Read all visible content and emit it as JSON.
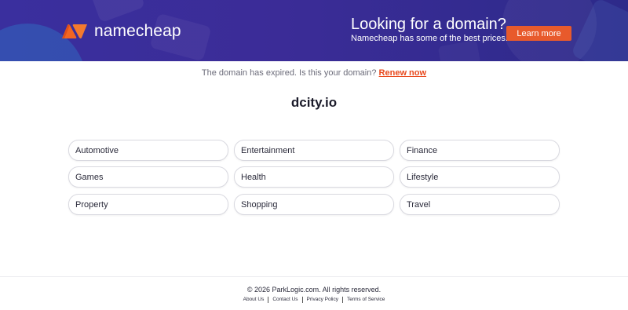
{
  "banner": {
    "brand": "namecheap",
    "promo_title": "Looking for a domain?",
    "promo_subtitle": "Namecheap has some of the best prices.",
    "cta_label": "Learn more",
    "colors": {
      "background": "#3a2f9e",
      "cta": "#e85a2c",
      "logo_orange": "#f26522"
    }
  },
  "notice": {
    "text": "The domain has expired. Is this your domain?",
    "link_label": "Renew now"
  },
  "domain": "dcity.io",
  "categories": [
    "Automotive",
    "Entertainment",
    "Finance",
    "Games",
    "Health",
    "Lifestyle",
    "Property",
    "Shopping",
    "Travel"
  ],
  "footer": {
    "copyright": "© 2026 ParkLogic.com. All rights reserved.",
    "links": [
      "About Us",
      "Contact Us",
      "Privacy Policy",
      "Terms of Service"
    ]
  }
}
